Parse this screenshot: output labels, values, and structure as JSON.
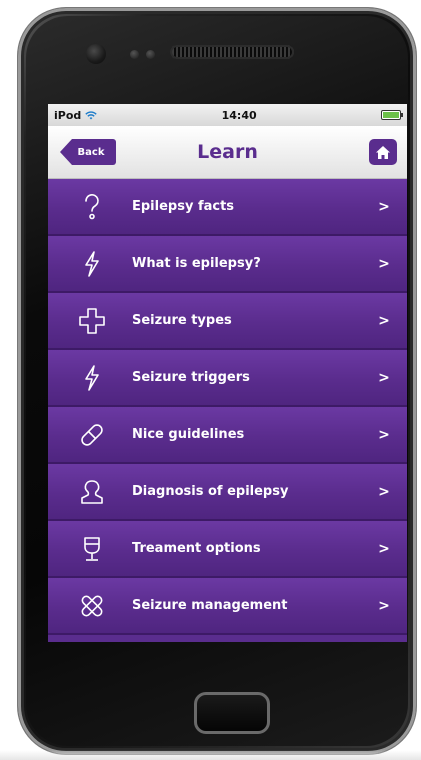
{
  "status_bar": {
    "carrier": "iPod",
    "time": "14:40"
  },
  "nav": {
    "back_label": "Back",
    "title": "Learn",
    "home_icon": "home-icon"
  },
  "menu": {
    "items": [
      {
        "label": "Epilepsy facts",
        "icon": "question-icon",
        "chevron": ">"
      },
      {
        "label": "What is epilepsy?",
        "icon": "lightning-icon",
        "chevron": ">"
      },
      {
        "label": "Seizure types",
        "icon": "cross-icon",
        "chevron": ">"
      },
      {
        "label": "Seizure triggers",
        "icon": "lightning-icon",
        "chevron": ">"
      },
      {
        "label": "Nice guidelines",
        "icon": "pill-icon",
        "chevron": ">"
      },
      {
        "label": "Diagnosis of epilepsy",
        "icon": "person-icon",
        "chevron": ">"
      },
      {
        "label": "Treament options",
        "icon": "cup-icon",
        "chevron": ">"
      },
      {
        "label": "Seizure management",
        "icon": "bandage-icon",
        "chevron": ">"
      }
    ]
  },
  "colors": {
    "primary": "#5a2d8e",
    "row_border": "#3d1a66"
  }
}
